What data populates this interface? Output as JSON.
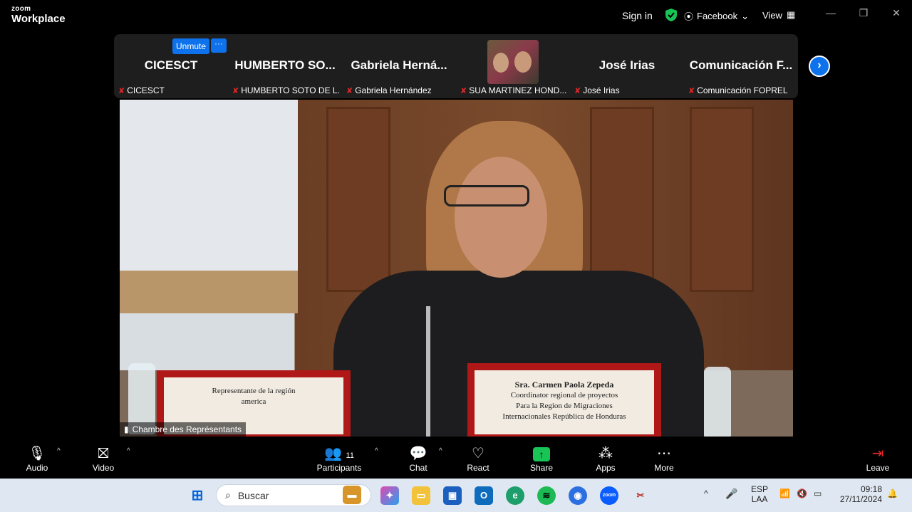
{
  "app": {
    "brand_line1": "zoom",
    "brand_line2": "Workplace"
  },
  "titlebar": {
    "sign_in": "Sign in",
    "stream_label": "Facebook",
    "view_label": "View",
    "shield_color": "#19c456"
  },
  "gallery": {
    "unmute_label": "Unmute",
    "more_label": "···",
    "tiles": [
      {
        "big": "CICESCT",
        "small": "CICESCT"
      },
      {
        "big": "HUMBERTO  SO...",
        "small": "HUMBERTO SOTO DE L..."
      },
      {
        "big": "Gabriela  Herná...",
        "small": "Gabriela Hernández"
      },
      {
        "big": "",
        "small": "SUA MARTINEZ HOND..."
      },
      {
        "big": "José Irias",
        "small": "José Irias"
      },
      {
        "big": "Comunicación  F...",
        "small": "Comunicación FOPREL"
      }
    ]
  },
  "video": {
    "label": "Chambre des Représentants",
    "placard_right": [
      "Sra. Carmen Paola Zepeda",
      "Coordinator regional de proyectos",
      "Para la Region de Migraciones",
      "Internacionales República de Honduras"
    ],
    "placard_left": [
      "Representante de la región",
      "america"
    ]
  },
  "toolbar": {
    "audio": "Audio",
    "video": "Video",
    "participants": "Participants",
    "participants_count": "11",
    "chat": "Chat",
    "react": "React",
    "share": "Share",
    "apps": "Apps",
    "more": "More",
    "leave": "Leave"
  },
  "taskbar": {
    "search_placeholder": "Buscar",
    "lang1": "ESP",
    "lang2": "LAA",
    "time": "09:18",
    "date": "27/11/2024"
  }
}
